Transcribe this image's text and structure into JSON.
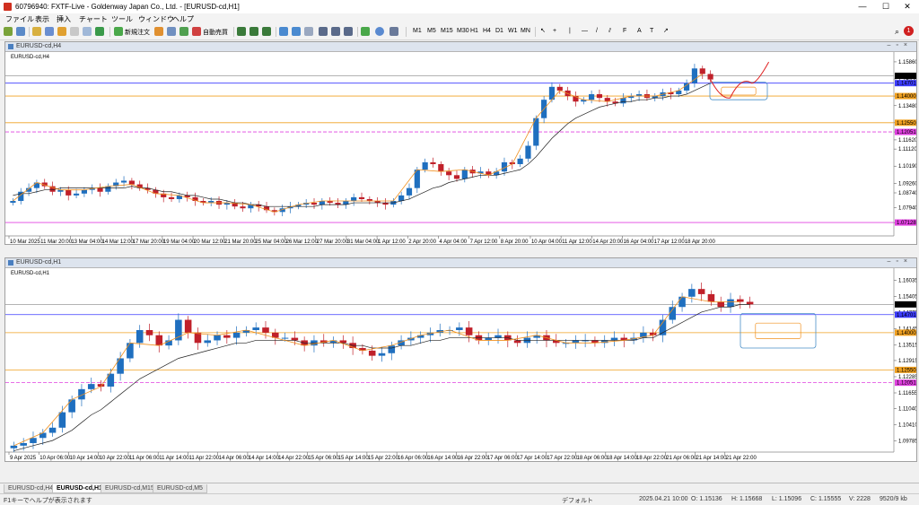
{
  "window": {
    "title": "60796940: FXTF-Live - Goldenway Japan Co., Ltd. - [EURUSD-cd,H1]"
  },
  "menu": [
    "ファイル",
    "表示",
    "挿入",
    "チャート",
    "ツール",
    "ウィンドウ",
    "ヘルプ"
  ],
  "toolbar": {
    "new_order": "新規注文",
    "auto_trade": "自動売買",
    "timeframes": [
      "M1",
      "M5",
      "M15",
      "M30",
      "H1",
      "H4",
      "D1",
      "W1",
      "MN"
    ]
  },
  "colors": {
    "bull": "#1f6fbf",
    "bear": "#c0202a",
    "ma": "#222222",
    "orange": "#f0901e",
    "level_blue": "#3c3cff",
    "level_orange": "#f0a020",
    "level_magenta": "#e040e0",
    "box": "#4a90c8"
  },
  "charts": [
    {
      "id": "h4",
      "title": "EURUSD-cd,H4",
      "label": "EURUSD-cd,H4",
      "price_min": 1.064,
      "price_max": 1.161,
      "price_ticks": [
        "1.15860",
        "1.14930",
        "1.14000",
        "1.13480",
        "1.12550",
        "1.12050",
        "1.11620",
        "1.11120",
        "1.10190",
        "1.09260",
        "1.08740",
        "1.07940",
        "1.07120"
      ],
      "tags": [
        {
          "text": "1.15100",
          "price": 1.151,
          "bg": "#000000",
          "fg": "#ffffff"
        },
        {
          "text": "1.14701",
          "price": 1.14701,
          "bg": "#3c3cff",
          "fg": "#ffffff"
        },
        {
          "text": "1.14000",
          "price": 1.14,
          "bg": "#f0a020",
          "fg": "#ffffff"
        },
        {
          "text": "1.12550",
          "price": 1.1255,
          "bg": "#f0a020",
          "fg": "#ffffff"
        },
        {
          "text": "1.12051",
          "price": 1.12051,
          "bg": "#e040e0",
          "fg": "#ffffff"
        },
        {
          "text": "1.07128",
          "price": 1.07128,
          "bg": "#e040e0",
          "fg": "#ffffff"
        }
      ],
      "time_labels": [
        "10 Mar 2025",
        "11 Mar 20:00",
        "13 Mar 04:00",
        "14 Mar 12:00",
        "17 Mar 20:00",
        "19 Mar 04:00",
        "20 Mar 12:00",
        "21 Mar 20:00",
        "25 Mar 04:00",
        "26 Mar 12:00",
        "27 Mar 20:00",
        "31 Mar 04:00",
        "1 Apr 12:00",
        "2 Apr 20:00",
        "4 Apr 04:00",
        "7 Apr 12:00",
        "8 Apr 20:00",
        "10 Apr 04:00",
        "11 Apr 12:00",
        "14 Apr 20:00",
        "16 Apr 04:00",
        "17 Apr 12:00",
        "18 Apr 20:00"
      ],
      "closes": [
        1.083,
        1.088,
        1.09,
        1.093,
        1.091,
        1.088,
        1.089,
        1.086,
        1.087,
        1.089,
        1.09,
        1.088,
        1.091,
        1.093,
        1.094,
        1.092,
        1.09,
        1.089,
        1.087,
        1.085,
        1.084,
        1.086,
        1.085,
        1.083,
        1.082,
        1.083,
        1.081,
        1.082,
        1.08,
        1.079,
        1.081,
        1.08,
        1.078,
        1.077,
        1.079,
        1.08,
        1.081,
        1.082,
        1.081,
        1.083,
        1.082,
        1.081,
        1.083,
        1.085,
        1.084,
        1.083,
        1.082,
        1.081,
        1.083,
        1.086,
        1.09,
        1.1,
        1.104,
        1.103,
        1.099,
        1.097,
        1.095,
        1.1,
        1.098,
        1.099,
        1.097,
        1.099,
        1.104,
        1.103,
        1.106,
        1.113,
        1.128,
        1.138,
        1.145,
        1.143,
        1.14,
        1.137,
        1.138,
        1.141,
        1.139,
        1.137,
        1.136,
        1.139,
        1.14,
        1.141,
        1.139,
        1.14,
        1.142,
        1.141,
        1.143,
        1.147,
        1.155,
        1.152,
        1.149
      ],
      "ma": [
        1.086,
        1.087,
        1.087,
        1.088,
        1.089,
        1.089,
        1.09,
        1.09,
        1.09,
        1.09,
        1.09,
        1.09,
        1.09,
        1.09,
        1.09,
        1.091,
        1.09,
        1.09,
        1.089,
        1.088,
        1.088,
        1.087,
        1.086,
        1.086,
        1.085,
        1.084,
        1.084,
        1.083,
        1.082,
        1.082,
        1.081,
        1.081,
        1.08,
        1.08,
        1.08,
        1.08,
        1.08,
        1.08,
        1.08,
        1.081,
        1.081,
        1.081,
        1.081,
        1.082,
        1.082,
        1.082,
        1.082,
        1.082,
        1.082,
        1.083,
        1.084,
        1.086,
        1.088,
        1.09,
        1.091,
        1.093,
        1.094,
        1.095,
        1.096,
        1.097,
        1.097,
        1.097,
        1.098,
        1.099,
        1.1,
        1.103,
        1.107,
        1.112,
        1.117,
        1.121,
        1.125,
        1.128,
        1.13,
        1.132,
        1.134,
        1.135,
        1.136,
        1.137,
        1.137,
        1.138,
        1.138,
        1.139,
        1.139,
        1.14,
        1.14,
        1.141,
        1.143,
        1.145,
        1.147
      ],
      "levels": [
        {
          "price": 1.151,
          "color": "#9a9a9a",
          "dash": false
        },
        {
          "price": 1.14701,
          "color": "#3c3cff",
          "dash": false
        },
        {
          "price": 1.14,
          "color": "#f0a020",
          "dash": false
        },
        {
          "price": 1.1255,
          "color": "#f0a020",
          "dash": false
        },
        {
          "price": 1.12051,
          "color": "#e040e0",
          "dash": true
        },
        {
          "price": 1.07128,
          "color": "#e040e0",
          "dash": false
        }
      ],
      "zone": {
        "p1": 1.1475,
        "p2": 1.138
      },
      "forecast": [
        [
          1.149,
          1.138
        ],
        [
          1.147,
          1.151
        ],
        [
          1.1585
        ]
      ]
    },
    {
      "id": "h1",
      "title": "EURUSD-cd,H1",
      "label": "EURUSD-cd,H1",
      "price_min": 1.0935,
      "price_max": 1.163,
      "price_ticks": [
        "1.16035",
        "1.15405",
        "1.14775",
        "1.14145",
        "1.13515",
        "1.12915",
        "1.12285",
        "1.11655",
        "1.11040",
        "1.10410",
        "1.09785",
        "1.09165"
      ],
      "tags": [
        {
          "text": "1.15100",
          "price": 1.151,
          "bg": "#000000",
          "fg": "#ffffff"
        },
        {
          "text": "1.14701",
          "price": 1.14701,
          "bg": "#3c3cff",
          "fg": "#ffffff"
        },
        {
          "text": "1.14000",
          "price": 1.14,
          "bg": "#f0a020",
          "fg": "#ffffff"
        },
        {
          "text": "1.12550",
          "price": 1.1255,
          "bg": "#f0a020",
          "fg": "#ffffff"
        },
        {
          "text": "1.12051",
          "price": 1.12051,
          "bg": "#e040e0",
          "fg": "#ffffff"
        }
      ],
      "time_labels": [
        "9 Apr 2025",
        "10 Apr 06:00",
        "10 Apr 14:00",
        "10 Apr 22:00",
        "11 Apr 06:00",
        "11 Apr 14:00",
        "11 Apr 22:00",
        "14 Apr 06:00",
        "14 Apr 14:00",
        "14 Apr 22:00",
        "15 Apr 06:00",
        "15 Apr 14:00",
        "15 Apr 22:00",
        "16 Apr 06:00",
        "16 Apr 14:00",
        "16 Apr 22:00",
        "17 Apr 06:00",
        "17 Apr 14:00",
        "17 Apr 22:00",
        "18 Apr 06:00",
        "18 Apr 14:00",
        "18 Apr 22:00",
        "21 Apr 06:00",
        "21 Apr 14:00",
        "21 Apr 22:00"
      ],
      "closes": [
        1.096,
        1.097,
        1.099,
        1.101,
        1.103,
        1.109,
        1.114,
        1.118,
        1.12,
        1.119,
        1.124,
        1.13,
        1.136,
        1.141,
        1.139,
        1.135,
        1.137,
        1.145,
        1.14,
        1.136,
        1.137,
        1.139,
        1.138,
        1.14,
        1.141,
        1.142,
        1.14,
        1.138,
        1.138,
        1.137,
        1.135,
        1.137,
        1.136,
        1.137,
        1.136,
        1.134,
        1.133,
        1.131,
        1.132,
        1.135,
        1.137,
        1.138,
        1.139,
        1.14,
        1.141,
        1.141,
        1.142,
        1.139,
        1.137,
        1.138,
        1.139,
        1.137,
        1.136,
        1.138,
        1.139,
        1.137,
        1.136,
        1.136,
        1.137,
        1.137,
        1.136,
        1.137,
        1.138,
        1.137,
        1.138,
        1.14,
        1.139,
        1.145,
        1.15,
        1.154,
        1.157,
        1.155,
        1.152,
        1.15,
        1.153,
        1.152,
        1.151
      ],
      "ma": [
        1.094,
        1.095,
        1.096,
        1.097,
        1.098,
        1.1,
        1.102,
        1.105,
        1.108,
        1.11,
        1.113,
        1.116,
        1.119,
        1.122,
        1.124,
        1.126,
        1.128,
        1.13,
        1.131,
        1.132,
        1.133,
        1.134,
        1.135,
        1.136,
        1.136,
        1.137,
        1.137,
        1.137,
        1.137,
        1.137,
        1.136,
        1.136,
        1.136,
        1.136,
        1.136,
        1.135,
        1.135,
        1.134,
        1.134,
        1.134,
        1.135,
        1.135,
        1.136,
        1.137,
        1.137,
        1.138,
        1.138,
        1.138,
        1.138,
        1.138,
        1.138,
        1.138,
        1.137,
        1.137,
        1.137,
        1.137,
        1.137,
        1.137,
        1.137,
        1.137,
        1.137,
        1.137,
        1.137,
        1.137,
        1.137,
        1.138,
        1.138,
        1.14,
        1.142,
        1.144,
        1.146,
        1.148,
        1.149,
        1.15,
        1.15,
        1.151,
        1.151
      ],
      "levels": [
        {
          "price": 1.151,
          "color": "#9a9a9a",
          "dash": false
        },
        {
          "price": 1.14701,
          "color": "#3c3cff",
          "dash": false
        },
        {
          "price": 1.14,
          "color": "#f0a020",
          "dash": false
        },
        {
          "price": 1.1255,
          "color": "#f0a020",
          "dash": false
        },
        {
          "price": 1.12051,
          "color": "#e040e0",
          "dash": true
        }
      ],
      "zone": {
        "p1": 1.1475,
        "p2": 1.134
      },
      "forecast": null
    }
  ],
  "tabs": [
    "EURUSD-cd,H4",
    "EURUSD-cd,H1",
    "EURUSD-cd,M15",
    "EURUSD-cd,M5"
  ],
  "status": {
    "help": "F1キーでヘルプが表示されます",
    "profile": "デフォルト",
    "time": "2025.04.21 10:00",
    "open": "O: 1.15136",
    "high": "H: 1.15668",
    "low": "L: 1.15096",
    "close": "C: 1.15555",
    "volume": "V: 2228",
    "net": "9520/9 kb"
  }
}
